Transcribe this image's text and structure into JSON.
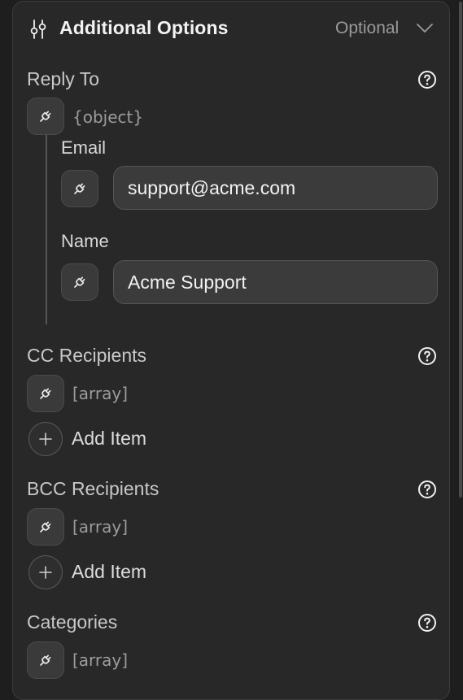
{
  "header": {
    "title": "Additional Options",
    "optional_label": "Optional",
    "icon": "sliders-icon",
    "toggle_icon": "chevron-down-icon"
  },
  "reply_to": {
    "label": "Reply To",
    "type": "{object}",
    "email": {
      "label": "Email",
      "value": "support@acme.com"
    },
    "name": {
      "label": "Name",
      "value": "Acme Support"
    }
  },
  "cc_recipients": {
    "label": "CC Recipients",
    "type": "[array]",
    "add_label": "Add Item"
  },
  "bcc_recipients": {
    "label": "BCC Recipients",
    "type": "[array]",
    "add_label": "Add Item"
  },
  "categories": {
    "label": "Categories",
    "type": "[array]"
  },
  "colors": {
    "panel": "#282828",
    "background": "#1e1e1e",
    "text": "#e6e6e6",
    "muted": "#9a9a9a"
  }
}
